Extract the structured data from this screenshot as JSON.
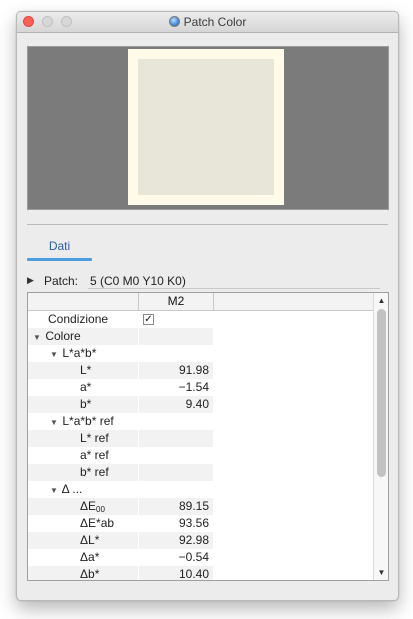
{
  "window": {
    "title": "Patch Color"
  },
  "preview": {
    "outer_color": "#fffbe8",
    "inner_color": "#e7e6d8",
    "background": "#7b7b7b"
  },
  "tabs": [
    {
      "label": "Dati",
      "active": true
    }
  ],
  "patch": {
    "label": "Patch:",
    "value": "5 (C0 M0 Y10 K0)"
  },
  "table": {
    "column_header": "M2",
    "rows": [
      {
        "label": "Condizione",
        "indent": 1,
        "disclosure": "",
        "checked": true,
        "value": ""
      },
      {
        "label": "Colore",
        "indent": 0,
        "disclosure": "open",
        "value": ""
      },
      {
        "label": "L*a*b*",
        "indent": 1,
        "disclosure": "open",
        "value": ""
      },
      {
        "label": "L*",
        "indent": 2,
        "disclosure": "",
        "value": "91.98"
      },
      {
        "label": "a*",
        "indent": 2,
        "disclosure": "",
        "value": "−1.54"
      },
      {
        "label": "b*",
        "indent": 2,
        "disclosure": "",
        "value": "9.40"
      },
      {
        "label": "L*a*b* ref",
        "indent": 1,
        "disclosure": "open",
        "value": ""
      },
      {
        "label": "L* ref",
        "indent": 2,
        "disclosure": "",
        "value": ""
      },
      {
        "label": "a* ref",
        "indent": 2,
        "disclosure": "",
        "value": ""
      },
      {
        "label": "b* ref",
        "indent": 2,
        "disclosure": "",
        "value": ""
      },
      {
        "label": "Δ ...",
        "indent": 1,
        "disclosure": "open",
        "value": ""
      },
      {
        "label": "ΔE",
        "sub": "00",
        "indent": 2,
        "disclosure": "",
        "value": "89.15"
      },
      {
        "label": "ΔE*ab",
        "indent": 2,
        "disclosure": "",
        "value": "93.56"
      },
      {
        "label": "ΔL*",
        "indent": 2,
        "disclosure": "",
        "value": "92.98"
      },
      {
        "label": "Δa*",
        "indent": 2,
        "disclosure": "",
        "value": "−0.54"
      },
      {
        "label": "Δb*",
        "indent": 2,
        "disclosure": "",
        "value": "10.40"
      }
    ]
  }
}
